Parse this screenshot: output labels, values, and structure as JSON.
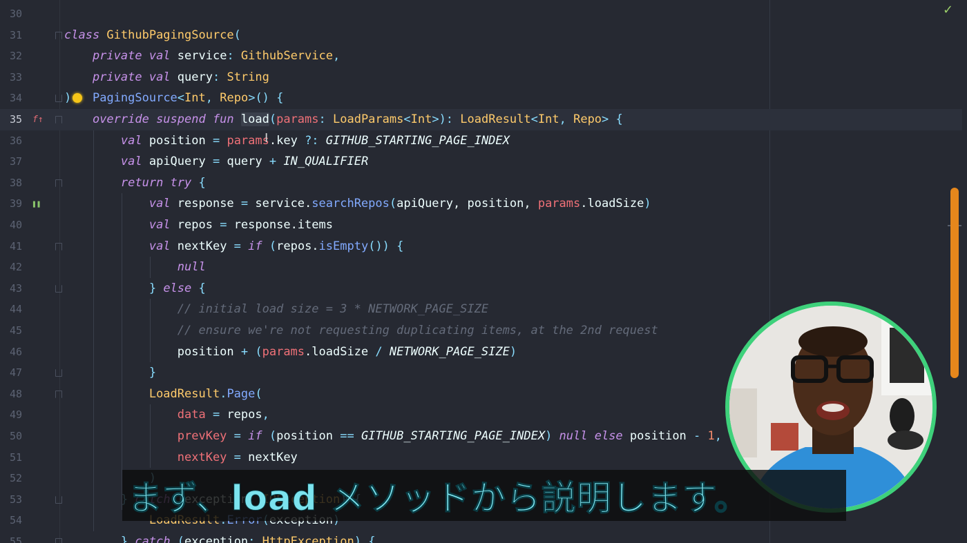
{
  "editor": {
    "lines": [
      {
        "number": "30",
        "current": false,
        "fold": "",
        "gutter_icon": "",
        "tokens": []
      },
      {
        "number": "31",
        "current": false,
        "fold": "open",
        "gutter_icon": "",
        "tokens": [
          {
            "t": "class ",
            "c": "kw"
          },
          {
            "t": "GithubPagingSource",
            "c": "cls"
          },
          {
            "t": "(",
            "c": "punc"
          }
        ]
      },
      {
        "number": "32",
        "current": false,
        "fold": "",
        "gutter_icon": "",
        "tokens": [
          {
            "t": "    ",
            "c": "plain"
          },
          {
            "t": "private val ",
            "c": "kw"
          },
          {
            "t": "service",
            "c": "plain"
          },
          {
            "t": ": ",
            "c": "punc"
          },
          {
            "t": "GithubService",
            "c": "type"
          },
          {
            "t": ",",
            "c": "punc"
          }
        ]
      },
      {
        "number": "33",
        "current": false,
        "fold": "",
        "gutter_icon": "",
        "tokens": [
          {
            "t": "    ",
            "c": "plain"
          },
          {
            "t": "private val ",
            "c": "kw"
          },
          {
            "t": "query",
            "c": "plain"
          },
          {
            "t": ": ",
            "c": "punc"
          },
          {
            "t": "String",
            "c": "type"
          }
        ]
      },
      {
        "number": "34",
        "current": false,
        "fold": "close",
        "gutter_icon": "",
        "bulb": true,
        "tokens": [
          {
            "t": ")",
            "c": "punc"
          },
          {
            "t": "  ",
            "c": "plain"
          },
          {
            "t": " PagingSource",
            "c": "fn"
          },
          {
            "t": "<",
            "c": "punc"
          },
          {
            "t": "Int",
            "c": "type"
          },
          {
            "t": ", ",
            "c": "punc"
          },
          {
            "t": "Repo",
            "c": "type"
          },
          {
            "t": ">() {",
            "c": "punc"
          }
        ]
      },
      {
        "number": "35",
        "current": true,
        "fold": "open",
        "gutter_icon": "override-icon",
        "tokens": [
          {
            "t": "    ",
            "c": "plain"
          },
          {
            "t": "override suspend fun ",
            "c": "kw"
          },
          {
            "t": "load",
            "c": "hl"
          },
          {
            "t": "(",
            "c": "punc"
          },
          {
            "t": "params",
            "c": "param"
          },
          {
            "t": ": ",
            "c": "punc"
          },
          {
            "t": "LoadParams",
            "c": "type"
          },
          {
            "t": "<",
            "c": "punc"
          },
          {
            "t": "Int",
            "c": "type"
          },
          {
            "t": ">): ",
            "c": "punc"
          },
          {
            "t": "LoadResult",
            "c": "type"
          },
          {
            "t": "<",
            "c": "punc"
          },
          {
            "t": "Int",
            "c": "type"
          },
          {
            "t": ", ",
            "c": "punc"
          },
          {
            "t": "Repo",
            "c": "type"
          },
          {
            "t": "> {",
            "c": "punc"
          }
        ]
      },
      {
        "number": "36",
        "current": false,
        "fold": "",
        "gutter_icon": "",
        "tokens": [
          {
            "t": "        ",
            "c": "plain"
          },
          {
            "t": "val ",
            "c": "kw"
          },
          {
            "t": "position ",
            "c": "plain"
          },
          {
            "t": "= ",
            "c": "punc"
          },
          {
            "t": "params",
            "c": "param"
          },
          {
            "t": ".key ",
            "c": "plain"
          },
          {
            "t": "?: ",
            "c": "punc"
          },
          {
            "t": "GITHUB_STARTING_PAGE_INDEX",
            "c": "const"
          }
        ]
      },
      {
        "number": "37",
        "current": false,
        "fold": "",
        "gutter_icon": "",
        "tokens": [
          {
            "t": "        ",
            "c": "plain"
          },
          {
            "t": "val ",
            "c": "kw"
          },
          {
            "t": "apiQuery ",
            "c": "plain"
          },
          {
            "t": "= ",
            "c": "punc"
          },
          {
            "t": "query ",
            "c": "plain"
          },
          {
            "t": "+ ",
            "c": "punc"
          },
          {
            "t": "IN_QUALIFIER",
            "c": "const"
          }
        ]
      },
      {
        "number": "38",
        "current": false,
        "fold": "open",
        "gutter_icon": "",
        "tokens": [
          {
            "t": "        ",
            "c": "plain"
          },
          {
            "t": "return try ",
            "c": "kw"
          },
          {
            "t": "{",
            "c": "punc"
          }
        ]
      },
      {
        "number": "39",
        "current": false,
        "fold": "",
        "gutter_icon": "suspend-icon",
        "tokens": [
          {
            "t": "            ",
            "c": "plain"
          },
          {
            "t": "val ",
            "c": "kw"
          },
          {
            "t": "response ",
            "c": "plain"
          },
          {
            "t": "= ",
            "c": "punc"
          },
          {
            "t": "service.",
            "c": "plain"
          },
          {
            "t": "searchRepos",
            "c": "fn"
          },
          {
            "t": "(",
            "c": "punc"
          },
          {
            "t": "apiQuery, position, ",
            "c": "plain"
          },
          {
            "t": "params",
            "c": "param"
          },
          {
            "t": ".loadSize",
            "c": "plain"
          },
          {
            "t": ")",
            "c": "punc"
          }
        ]
      },
      {
        "number": "40",
        "current": false,
        "fold": "",
        "gutter_icon": "",
        "tokens": [
          {
            "t": "            ",
            "c": "plain"
          },
          {
            "t": "val ",
            "c": "kw"
          },
          {
            "t": "repos ",
            "c": "plain"
          },
          {
            "t": "= ",
            "c": "punc"
          },
          {
            "t": "response.items",
            "c": "plain"
          }
        ]
      },
      {
        "number": "41",
        "current": false,
        "fold": "open",
        "gutter_icon": "",
        "tokens": [
          {
            "t": "            ",
            "c": "plain"
          },
          {
            "t": "val ",
            "c": "kw"
          },
          {
            "t": "nextKey ",
            "c": "plain"
          },
          {
            "t": "= ",
            "c": "punc"
          },
          {
            "t": "if ",
            "c": "kw"
          },
          {
            "t": "(",
            "c": "punc"
          },
          {
            "t": "repos.",
            "c": "plain"
          },
          {
            "t": "isEmpty",
            "c": "fn"
          },
          {
            "t": "()) {",
            "c": "punc"
          }
        ]
      },
      {
        "number": "42",
        "current": false,
        "fold": "",
        "gutter_icon": "",
        "tokens": [
          {
            "t": "                ",
            "c": "plain"
          },
          {
            "t": "null",
            "c": "kw"
          }
        ]
      },
      {
        "number": "43",
        "current": false,
        "fold": "close",
        "gutter_icon": "",
        "tokens": [
          {
            "t": "            ",
            "c": "plain"
          },
          {
            "t": "} ",
            "c": "punc"
          },
          {
            "t": "else ",
            "c": "kw"
          },
          {
            "t": "{",
            "c": "punc"
          }
        ]
      },
      {
        "number": "44",
        "current": false,
        "fold": "",
        "gutter_icon": "",
        "tokens": [
          {
            "t": "                ",
            "c": "plain"
          },
          {
            "t": "// initial load size = 3 * NETWORK_PAGE_SIZE",
            "c": "comment"
          }
        ]
      },
      {
        "number": "45",
        "current": false,
        "fold": "",
        "gutter_icon": "",
        "tokens": [
          {
            "t": "                ",
            "c": "plain"
          },
          {
            "t": "// ensure we're not requesting duplicating items, at the 2nd request",
            "c": "comment"
          }
        ]
      },
      {
        "number": "46",
        "current": false,
        "fold": "",
        "gutter_icon": "",
        "tokens": [
          {
            "t": "                ",
            "c": "plain"
          },
          {
            "t": "position ",
            "c": "plain"
          },
          {
            "t": "+ (",
            "c": "punc"
          },
          {
            "t": "params",
            "c": "param"
          },
          {
            "t": ".loadSize ",
            "c": "plain"
          },
          {
            "t": "/ ",
            "c": "punc"
          },
          {
            "t": "NETWORK_PAGE_SIZE",
            "c": "const"
          },
          {
            "t": ")",
            "c": "punc"
          }
        ]
      },
      {
        "number": "47",
        "current": false,
        "fold": "close",
        "gutter_icon": "",
        "tokens": [
          {
            "t": "            ",
            "c": "plain"
          },
          {
            "t": "}",
            "c": "punc"
          }
        ]
      },
      {
        "number": "48",
        "current": false,
        "fold": "open",
        "gutter_icon": "",
        "tokens": [
          {
            "t": "            ",
            "c": "plain"
          },
          {
            "t": "LoadResult",
            "c": "type"
          },
          {
            "t": ".",
            "c": "punc"
          },
          {
            "t": "Page",
            "c": "fn"
          },
          {
            "t": "(",
            "c": "punc"
          }
        ]
      },
      {
        "number": "49",
        "current": false,
        "fold": "",
        "gutter_icon": "",
        "tokens": [
          {
            "t": "                ",
            "c": "plain"
          },
          {
            "t": "data ",
            "c": "param"
          },
          {
            "t": "= ",
            "c": "punc"
          },
          {
            "t": "repos",
            "c": "plain"
          },
          {
            "t": ",",
            "c": "punc"
          }
        ]
      },
      {
        "number": "50",
        "current": false,
        "fold": "",
        "gutter_icon": "",
        "tokens": [
          {
            "t": "                ",
            "c": "plain"
          },
          {
            "t": "prevKey ",
            "c": "param"
          },
          {
            "t": "= ",
            "c": "punc"
          },
          {
            "t": "if ",
            "c": "kw"
          },
          {
            "t": "(",
            "c": "punc"
          },
          {
            "t": "position ",
            "c": "plain"
          },
          {
            "t": "== ",
            "c": "punc"
          },
          {
            "t": "GITHUB_STARTING_PAGE_INDEX",
            "c": "const"
          },
          {
            "t": ") ",
            "c": "punc"
          },
          {
            "t": "null else ",
            "c": "kw"
          },
          {
            "t": "position ",
            "c": "plain"
          },
          {
            "t": "- ",
            "c": "punc"
          },
          {
            "t": "1",
            "c": "num"
          },
          {
            "t": ",",
            "c": "punc"
          }
        ]
      },
      {
        "number": "51",
        "current": false,
        "fold": "",
        "gutter_icon": "",
        "tokens": [
          {
            "t": "                ",
            "c": "plain"
          },
          {
            "t": "nextKey ",
            "c": "param"
          },
          {
            "t": "= ",
            "c": "punc"
          },
          {
            "t": "nextKey",
            "c": "plain"
          }
        ]
      },
      {
        "number": "52",
        "current": false,
        "fold": "",
        "gutter_icon": "",
        "tokens": [
          {
            "t": "            ",
            "c": "plain"
          },
          {
            "t": ")",
            "c": "punc"
          }
        ]
      },
      {
        "number": "53",
        "current": false,
        "fold": "close",
        "gutter_icon": "",
        "tokens": [
          {
            "t": "        ",
            "c": "plain"
          },
          {
            "t": "} ",
            "c": "punc"
          },
          {
            "t": "catch ",
            "c": "kw"
          },
          {
            "t": "(",
            "c": "punc"
          },
          {
            "t": "exception",
            "c": "plain"
          },
          {
            "t": ": ",
            "c": "punc"
          },
          {
            "t": "IOException",
            "c": "type"
          },
          {
            "t": ") {",
            "c": "punc"
          }
        ]
      },
      {
        "number": "54",
        "current": false,
        "fold": "",
        "gutter_icon": "",
        "tokens": [
          {
            "t": "            ",
            "c": "plain"
          },
          {
            "t": "LoadResult",
            "c": "type"
          },
          {
            "t": ".",
            "c": "punc"
          },
          {
            "t": "Error",
            "c": "fn"
          },
          {
            "t": "(",
            "c": "punc"
          },
          {
            "t": "exception",
            "c": "plain"
          },
          {
            "t": ")",
            "c": "punc"
          }
        ]
      },
      {
        "number": "55",
        "current": false,
        "fold": "open",
        "gutter_icon": "",
        "tokens": [
          {
            "t": "        ",
            "c": "plain"
          },
          {
            "t": "} ",
            "c": "punc"
          },
          {
            "t": "catch ",
            "c": "kw"
          },
          {
            "t": "(",
            "c": "punc"
          },
          {
            "t": "exception",
            "c": "plain"
          },
          {
            "t": ": ",
            "c": "punc"
          },
          {
            "t": "HttpException",
            "c": "type"
          },
          {
            "t": ") {",
            "c": "punc"
          }
        ]
      }
    ]
  },
  "subtitle": {
    "text": "まず、load メソッドから説明します。"
  },
  "colors": {
    "accent": "#3ed17b",
    "scrollbar": "#e6871c",
    "subtitle_text": "#7be3ee"
  },
  "icons": {
    "status": "check-icon",
    "gutter_override": "override-icon",
    "gutter_suspend": "suspend-icon",
    "intention": "lightbulb-icon"
  }
}
